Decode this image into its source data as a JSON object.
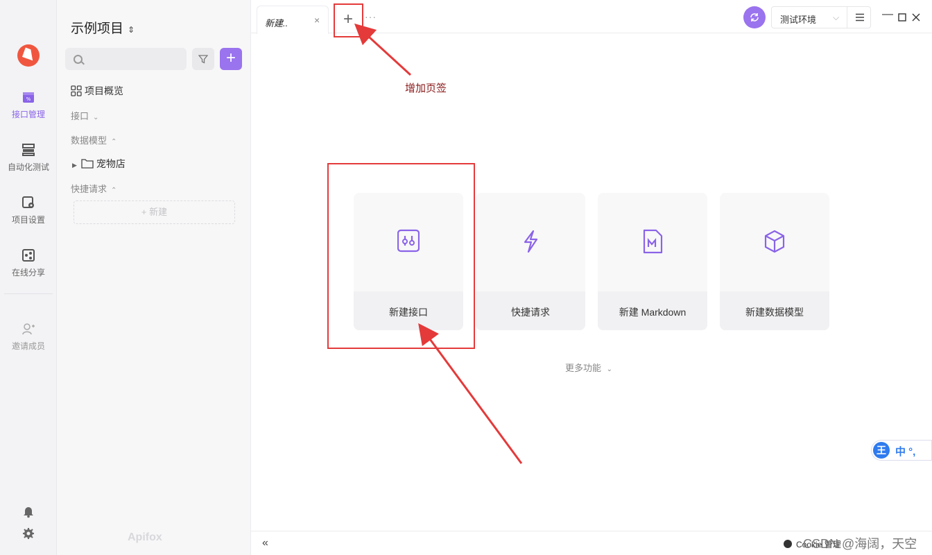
{
  "rail": {
    "items": [
      {
        "label": "接口管理",
        "icon": "api-icon"
      },
      {
        "label": "自动化测试",
        "icon": "automation-icon"
      },
      {
        "label": "项目设置",
        "icon": "project-settings-icon"
      },
      {
        "label": "在线分享",
        "icon": "share-icon"
      },
      {
        "label": "邀请成员",
        "icon": "invite-user-icon"
      }
    ]
  },
  "sidebar": {
    "project_title": "示例项目",
    "overview": "项目概览",
    "section_api": "接口",
    "section_models": "数据模型",
    "folder": "宠物店",
    "section_quick": "快捷请求",
    "new_label": "+ 新建",
    "brand": "Apifox"
  },
  "tabs": {
    "active_label": "新建..",
    "close": "×",
    "add": "+",
    "more": "···"
  },
  "toolbar": {
    "env_label": "测试环境",
    "accent": "#9a73ee"
  },
  "cards": [
    {
      "label": "新建接口",
      "icon": "api-card-icon"
    },
    {
      "label": "快捷请求",
      "icon": "lightning-icon"
    },
    {
      "label": "新建 Markdown",
      "icon": "markdown-icon"
    },
    {
      "label": "新建数据模型",
      "icon": "cube-icon"
    }
  ],
  "more_functions": "更多功能",
  "bottom": {
    "collapse": "«",
    "cookie": "Cookie 管理",
    "watermark": "CSDN @海阔，天空"
  },
  "annotation": {
    "text": "增加页签",
    "color": "#e43a3a"
  },
  "ime": {
    "logo": "王",
    "text": "中 °,"
  }
}
